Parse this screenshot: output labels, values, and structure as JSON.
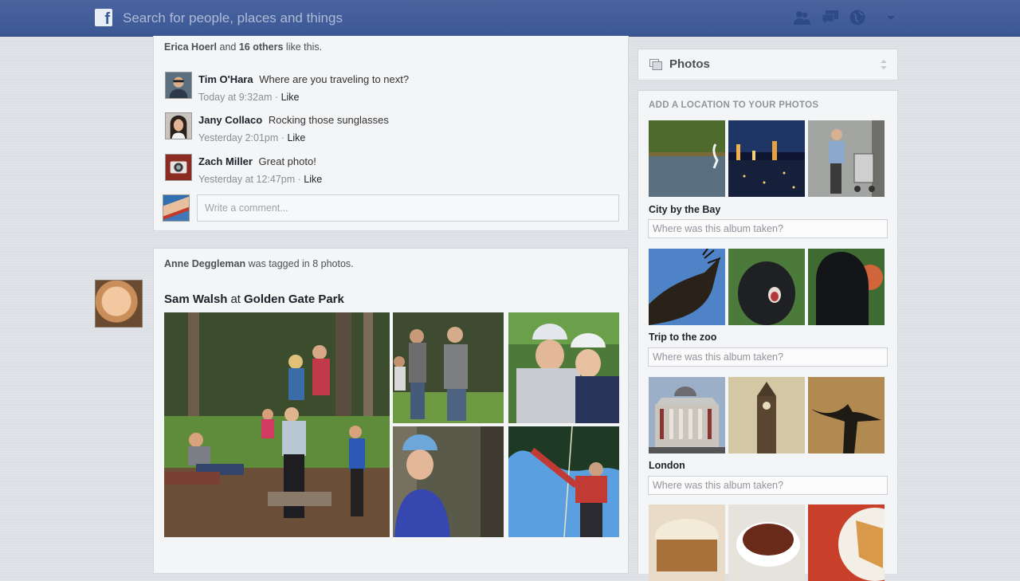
{
  "topbar": {
    "logo": "f",
    "search_placeholder": "Search for people, places and things",
    "icons": [
      "friend-requests-icon",
      "messages-icon",
      "notifications-globe-icon",
      "account-menu-caret-icon"
    ]
  },
  "feed": {
    "post1": {
      "likes": {
        "name": "Erica Hoerl",
        "and": "and",
        "others": "16 others",
        "suffix": "like this."
      },
      "comments": [
        {
          "name": "Tim O'Hara",
          "text": "Where are you traveling to next?",
          "time": "Today at 9:32am",
          "sep": "·",
          "like": "Like"
        },
        {
          "name": "Jany Collaco",
          "text": "Rocking those sunglasses",
          "time": "Yesterday 2:01pm",
          "sep": "·",
          "like": "Like"
        },
        {
          "name": "Zach Miller",
          "text": "Great photo!",
          "time": "Yesterday at 12:47pm",
          "sep": "·",
          "like": "Like"
        }
      ],
      "comment_placeholder": "Write a comment..."
    },
    "post2": {
      "actor": "Anne Deggleman",
      "action": "was tagged in 8 photos.",
      "person": "Sam Walsh",
      "at": "at",
      "place": "Golden Gate Park"
    }
  },
  "sidebar": {
    "title": "Photos",
    "heading": "ADD A LOCATION TO YOUR PHOTOS",
    "albums": [
      {
        "name": "City by the Bay",
        "placeholder": "Where was this album taken?"
      },
      {
        "name": "Trip to the zoo",
        "placeholder": "Where was this album taken?"
      },
      {
        "name": "London",
        "placeholder": "Where was this album taken?"
      }
    ]
  },
  "colors": {
    "brand": "#3b5998",
    "topbar": "#4a64a0",
    "card": "#f4f5f7",
    "page": "#dcdfe3"
  }
}
